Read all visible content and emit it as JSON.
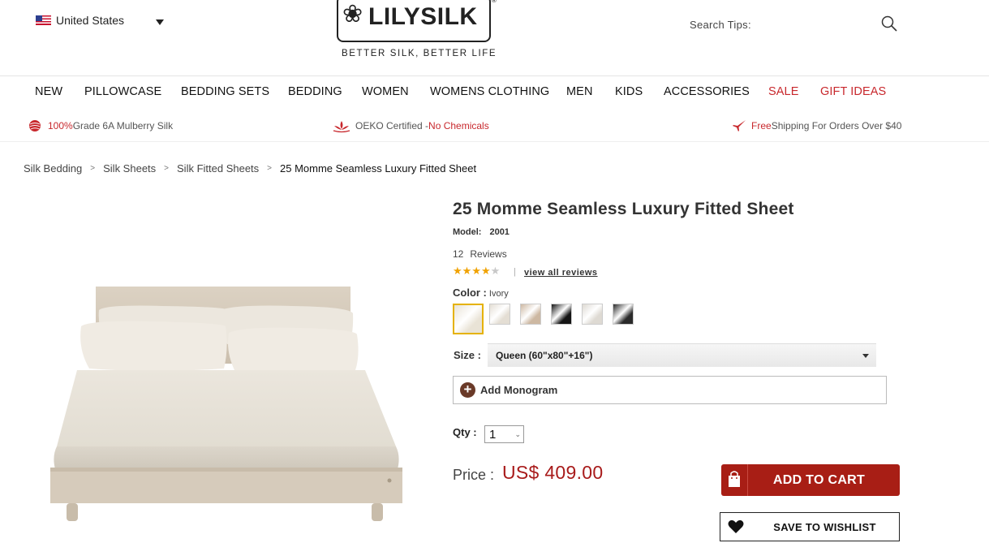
{
  "header": {
    "country": "United States",
    "logo_text": "LILYSILK",
    "logo_reg": "®",
    "tagline": "BETTER SILK, BETTER LIFE",
    "search_label": "Search Tips:"
  },
  "nav": {
    "items": [
      {
        "label": "NEW"
      },
      {
        "label": "PILLOWCASE"
      },
      {
        "label": "BEDDING SETS"
      },
      {
        "label": "BEDDING"
      },
      {
        "label": "WOMEN"
      },
      {
        "label": "WOMENS CLOTHING"
      },
      {
        "label": "MEN"
      },
      {
        "label": "KIDS"
      },
      {
        "label": "ACCESSORIES"
      },
      {
        "label": "SALE"
      },
      {
        "label": "GIFT IDEAS"
      }
    ],
    "highlight_color": "#c8282d"
  },
  "features": {
    "f1_red": "100%",
    "f1_text": " Grade 6A Mulberry Silk",
    "f2_text": "OEKO Certified - ",
    "f2_red": "No Chemicals",
    "f3_red": "Free",
    "f3_text": " Shipping For Orders Over $40"
  },
  "breadcrumb": {
    "items": [
      "Silk Bedding",
      "Silk Sheets",
      "Silk Fitted Sheets"
    ],
    "separator": ">",
    "current": "25 Momme Seamless Luxury Fitted Sheet"
  },
  "product": {
    "title": "25 Momme Seamless Luxury Fitted Sheet",
    "model_label": "Model:",
    "model_value": "2001",
    "reviews_count": "12",
    "reviews_label": "Reviews",
    "rating": 4,
    "rating_max": 5,
    "review_sep": "|",
    "view_all": "view all reviews",
    "color_label": "Color :",
    "color_selected": "Ivory",
    "swatch_colors": [
      "#e9e3d6",
      "#e4ded4",
      "#cdb8a2",
      "#151515",
      "#dedad3",
      "#2a2a2a"
    ],
    "size_label": "Size :",
    "size_value": "Queen (60\"x80\"+16\")",
    "monogram_label": "Add Monogram",
    "qty_label": "Qty :",
    "qty_value": "1",
    "price_label": "Price :",
    "price_value": "US$ 409.00",
    "add_to_cart": "ADD TO CART",
    "save_to_wishlist": "SAVE TO WISHLIST",
    "accent_color": "#a81e15"
  }
}
